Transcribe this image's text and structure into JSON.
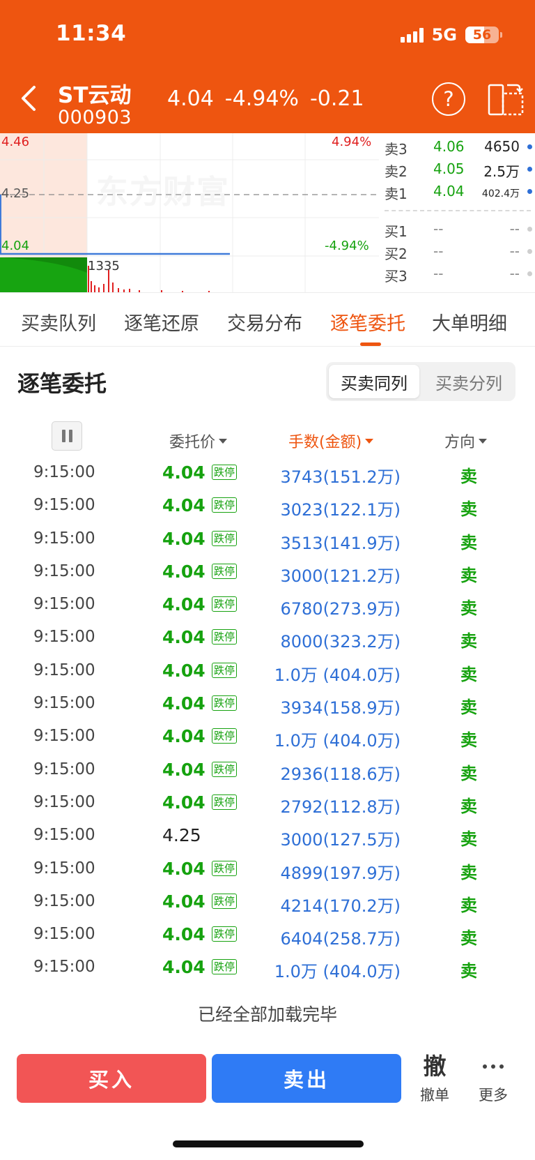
{
  "status_bar": {
    "time": "11:34",
    "network": "5G",
    "battery": "56"
  },
  "header": {
    "stock_name": "ST云动",
    "stock_code": "000903",
    "price": "4.04",
    "change_pct": "-4.94%",
    "change": "-0.21"
  },
  "chart": {
    "high_price": "4.46",
    "mid_price": "4.25",
    "low_price": "4.04",
    "high_pct": "4.94%",
    "low_pct": "-4.94%",
    "volume_label": "1335",
    "watermark": "东方财富"
  },
  "order_book": [
    {
      "label": "卖3",
      "price": "4.06",
      "volume": "4650",
      "volume_small": false,
      "na": false
    },
    {
      "label": "卖2",
      "price": "4.05",
      "volume": "2.5万",
      "volume_small": false,
      "na": false
    },
    {
      "label": "卖1",
      "price": "4.04",
      "volume": "402.4万",
      "volume_small": true,
      "na": false
    },
    {
      "label": "买1",
      "price": "--",
      "volume": "--",
      "volume_small": false,
      "na": true
    },
    {
      "label": "买2",
      "price": "--",
      "volume": "--",
      "volume_small": false,
      "na": true
    },
    {
      "label": "买3",
      "price": "--",
      "volume": "--",
      "volume_small": false,
      "na": true
    }
  ],
  "tabs": [
    {
      "label": "买卖队列",
      "active": false
    },
    {
      "label": "逐笔还原",
      "active": false
    },
    {
      "label": "交易分布",
      "active": false
    },
    {
      "label": "逐笔委托",
      "active": true
    },
    {
      "label": "大单明细",
      "active": false
    }
  ],
  "section": {
    "title": "逐笔委托",
    "segments": [
      {
        "label": "买卖同列",
        "active": true
      },
      {
        "label": "买卖分列",
        "active": false
      }
    ]
  },
  "table": {
    "columns": {
      "price": "委托价",
      "amount": "手数(金额)",
      "direction": "方向"
    },
    "limit_tag": "跌停",
    "rows": [
      {
        "time": "9:15:00",
        "price": "4.04",
        "limit": true,
        "amount": "3743(151.2万)",
        "direction": "卖"
      },
      {
        "time": "9:15:00",
        "price": "4.04",
        "limit": true,
        "amount": "3023(122.1万)",
        "direction": "卖"
      },
      {
        "time": "9:15:00",
        "price": "4.04",
        "limit": true,
        "amount": "3513(141.9万)",
        "direction": "卖"
      },
      {
        "time": "9:15:00",
        "price": "4.04",
        "limit": true,
        "amount": "3000(121.2万)",
        "direction": "卖"
      },
      {
        "time": "9:15:00",
        "price": "4.04",
        "limit": true,
        "amount": "6780(273.9万)",
        "direction": "卖"
      },
      {
        "time": "9:15:00",
        "price": "4.04",
        "limit": true,
        "amount": "8000(323.2万)",
        "direction": "卖"
      },
      {
        "time": "9:15:00",
        "price": "4.04",
        "limit": true,
        "amount": "1.0万 (404.0万)",
        "direction": "卖"
      },
      {
        "time": "9:15:00",
        "price": "4.04",
        "limit": true,
        "amount": "3934(158.9万)",
        "direction": "卖"
      },
      {
        "time": "9:15:00",
        "price": "4.04",
        "limit": true,
        "amount": "1.0万 (404.0万)",
        "direction": "卖"
      },
      {
        "time": "9:15:00",
        "price": "4.04",
        "limit": true,
        "amount": "2936(118.6万)",
        "direction": "卖"
      },
      {
        "time": "9:15:00",
        "price": "4.04",
        "limit": true,
        "amount": "2792(112.8万)",
        "direction": "卖"
      },
      {
        "time": "9:15:00",
        "price": "4.25",
        "limit": false,
        "amount": "3000(127.5万)",
        "direction": "卖"
      },
      {
        "time": "9:15:00",
        "price": "4.04",
        "limit": true,
        "amount": "4899(197.9万)",
        "direction": "卖"
      },
      {
        "time": "9:15:00",
        "price": "4.04",
        "limit": true,
        "amount": "4214(170.2万)",
        "direction": "卖"
      },
      {
        "time": "9:15:00",
        "price": "4.04",
        "limit": true,
        "amount": "6404(258.7万)",
        "direction": "卖"
      },
      {
        "time": "9:15:00",
        "price": "4.04",
        "limit": true,
        "amount": "1.0万 (404.0万)",
        "direction": "卖"
      }
    ],
    "loaded_text": "已经全部加载完毕"
  },
  "bottom_bar": {
    "buy_label": "买入",
    "sell_label": "卖出",
    "cancel_icon_char": "撤",
    "cancel_label": "撤单",
    "more_label": "更多"
  },
  "colors": {
    "brand": "#ee5510",
    "down_green": "#16a20f",
    "up_red": "#e02020",
    "amount_blue": "#2e6fd6"
  }
}
